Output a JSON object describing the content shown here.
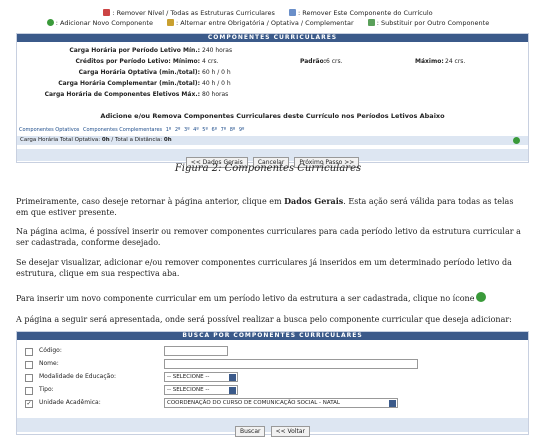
{
  "legend": {
    "remove_level": ": Remover Nível / Todas as Estruturas Curriculares",
    "remove_component": ": Remover Este Componente do Currículo",
    "add_component": ": Adicionar Novo Componente",
    "toggle_type": ": Alternar entre Obrigatória / Optativa / Complementar",
    "substitute": ": Substituir por Outro Componente"
  },
  "components_panel": {
    "title": "COMPONENTES CURRICULARES",
    "min_workload_label": "Carga Horária por Período Letivo Mín.:",
    "min_workload_value": "240 horas",
    "credits_label": "Créditos por Período Letivo: Mínimo:",
    "credits_min_value": "4 crs.",
    "standard_label": "Padrão:",
    "standard_value": "6 crs.",
    "max_label": "Máximo:",
    "max_value": "24 crs.",
    "optional_label": "Carga Horária Optativa (min./total):",
    "optional_value": "60 h / 0 h",
    "complementary_label": "Carga Horária Complementar (min./total):",
    "complementary_value": "40 h / 0 h",
    "elective_label": "Carga Horária de Componentes Eletivos Máx.:",
    "elective_value": "80 horas",
    "subtitle": "Adicione e/ou Remova Componentes Curriculares deste Currículo nos Períodos Letivos Abaixo",
    "tabs": [
      "Componentes Optativos",
      "Componentes Complementares",
      "1º",
      "2º",
      "3º",
      "4º",
      "5º",
      "6º",
      "7º",
      "8º",
      "9º"
    ],
    "total_label": "Carga Horária Total Optativa:",
    "total_value": "0h",
    "distance_label": "/ Total a Distância:",
    "distance_value": "0h",
    "buttons": {
      "back": "<< Dados Gerais",
      "cancel": "Cancelar",
      "next": "Próximo Passo >>"
    }
  },
  "caption": "Figura 2: Componentes Curriculares",
  "paragraphs": {
    "p1_a": "Primeiramente, caso deseje retornar à página anterior, clique em ",
    "p1_bold": "Dados Gerais",
    "p1_b": ". Esta ação será válida para todas as telas em que estiver presente.",
    "p2": "Na página acima, é possível inserir ou remover componentes curriculares para cada período letivo da estrutura curricular a ser cadastrada, conforme desejado.",
    "p3": "Se desejar visualizar, adicionar e/ou remover componentes curriculares já inseridos em um determinado período letivo da estrutura, clique em sua respectiva aba.",
    "p4": "Para inserir um novo componente curricular em um período letivo da estrutura a ser cadastrada, clique no ícone",
    "p5": "A página a seguir será apresentada, onde será possível realizar a busca pelo componente curricular que deseja adicionar:"
  },
  "search_panel": {
    "title": "BUSCA POR COMPONENTES CURRICULARES",
    "fields": [
      {
        "label": "Código:",
        "value": "",
        "checked": false
      },
      {
        "label": "Nome:",
        "value": "",
        "checked": false
      },
      {
        "label": "Modalidade de Educação:",
        "value": "-- SELECIONE --",
        "checked": false
      },
      {
        "label": "Tipo:",
        "value": "-- SELECIONE --",
        "checked": false
      },
      {
        "label": "Unidade Acadêmica:",
        "value": "COORDENAÇÃO DO CURSO DE COMUNICAÇÃO SOCIAL - NATAL",
        "checked": true
      }
    ],
    "buttons": {
      "search": "Buscar",
      "back": "<< Voltar"
    }
  }
}
